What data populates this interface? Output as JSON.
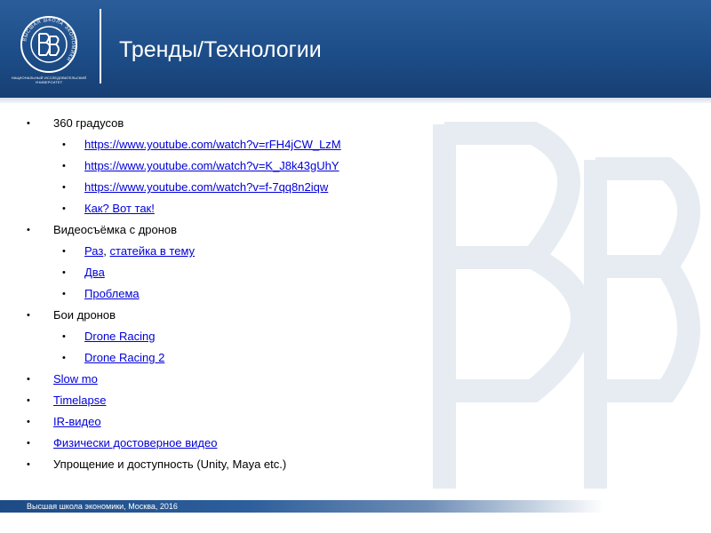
{
  "header": {
    "title": "Тренды/Технологии",
    "logo_caption": "НАЦИОНАЛЬНЫЙ ИССЛЕДОВАТЕЛЬСКИЙ УНИВЕРСИТЕТ",
    "logo_ring_text": "ВЫСШАЯ ШКОЛА ЭКОНОМИКИ",
    "logo_icon": "hse-logo-icon"
  },
  "content": {
    "items": [
      {
        "label": "360 градусов"
      },
      {
        "label": "https://www.youtube.com/watch?v=rFH4jCW_LzM"
      },
      {
        "label": "https://www.youtube.com/watch?v=K_J8k43gUhY"
      },
      {
        "label": "https://www.youtube.com/watch?v=f-7qq8n2iqw"
      },
      {
        "label": "Как? Вот так!"
      },
      {
        "label": "Видеосъёмка с дронов"
      },
      {
        "label": "Раз",
        "label_extra": "статейка в тему"
      },
      {
        "label": "Два"
      },
      {
        "label": "Проблема"
      },
      {
        "label": "Бои дронов"
      },
      {
        "label": "Drone Racing"
      },
      {
        "label": "Drone Racing 2"
      },
      {
        "label": "Slow mo"
      },
      {
        "label": "Timelapse"
      },
      {
        "label": "IR-видео"
      },
      {
        "label": "Физически  достоверное видео"
      },
      {
        "label": "Упрощение  и доступность  (Unity,  Maya etc.)"
      }
    ]
  },
  "footer": {
    "text": "Высшая школа  экономики, Москва, 2016"
  },
  "colors": {
    "header_bg": "#1d4d88",
    "link": "#0000d8",
    "text": "#000000"
  }
}
